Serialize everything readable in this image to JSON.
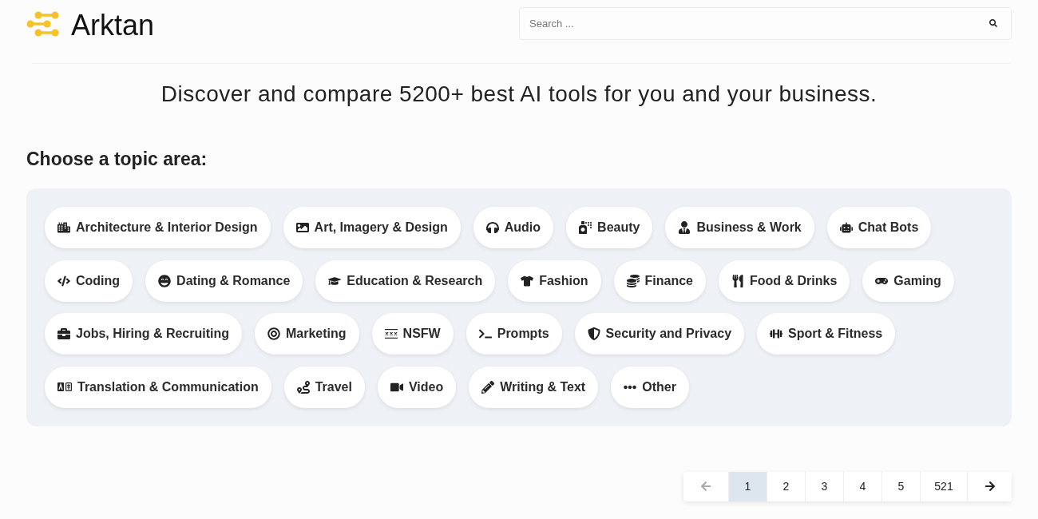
{
  "header": {
    "brand": "Arktan",
    "search": {
      "placeholder": "Search ..."
    }
  },
  "tagline": "Discover and compare 5200+ best AI tools for you and your business.",
  "topics": {
    "heading": "Choose a topic area:",
    "items": [
      "Architecture & Interior Design",
      "Art, Imagery & Design",
      "Audio",
      "Beauty",
      "Business & Work",
      "Chat Bots",
      "Coding",
      "Dating & Romance",
      "Education & Research",
      "Fashion",
      "Finance",
      "Food & Drinks",
      "Gaming",
      "Jobs, Hiring & Recruiting",
      "Marketing",
      "NSFW",
      "Prompts",
      "Security and Privacy",
      "Sport & Fitness",
      "Translation & Communication",
      "Travel",
      "Video",
      "Writing & Text",
      "Other"
    ]
  },
  "pagination": {
    "previous": {
      "disabled": true
    },
    "pages": [
      {
        "label": "1",
        "selected": true
      },
      {
        "label": "2",
        "selected": false
      },
      {
        "label": "3",
        "selected": false
      },
      {
        "label": "4",
        "selected": false
      },
      {
        "label": "5",
        "selected": false
      },
      {
        "label": "521",
        "selected": false
      }
    ],
    "next": {
      "disabled": false
    }
  }
}
